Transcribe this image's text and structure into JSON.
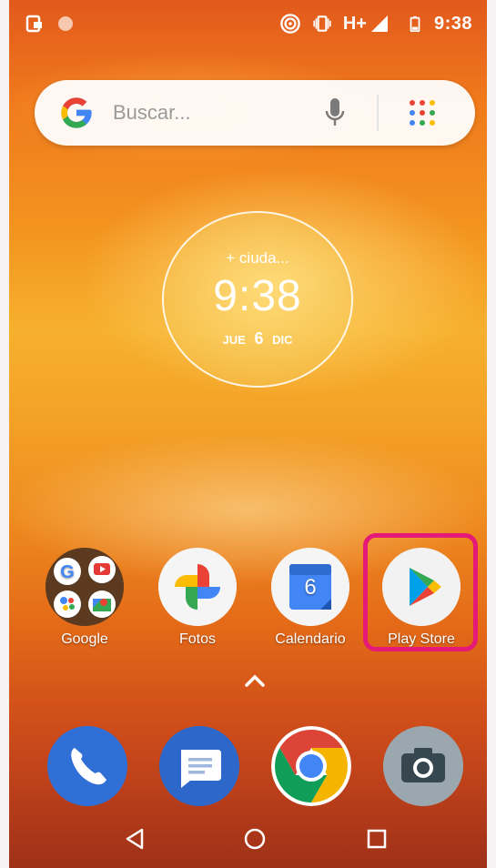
{
  "status_bar": {
    "network": "H+",
    "time": "9:38"
  },
  "search": {
    "placeholder": "Buscar..."
  },
  "clock_widget": {
    "city": "+ ciuda...",
    "time": "9:38",
    "weekday": "JUE",
    "day": "6",
    "month": "DIC"
  },
  "apps": [
    {
      "label": "Google",
      "icon": "google-folder-icon"
    },
    {
      "label": "Fotos",
      "icon": "photos-pinwheel-icon"
    },
    {
      "label": "Calendario",
      "icon": "calendar-icon",
      "badge": "6"
    },
    {
      "label": "Play Store",
      "icon": "play-store-icon"
    }
  ],
  "dock": [
    {
      "icon": "phone-icon"
    },
    {
      "icon": "messages-icon"
    },
    {
      "icon": "chrome-icon"
    },
    {
      "icon": "camera-icon"
    }
  ],
  "nav": [
    "back-icon",
    "home-icon",
    "recents-icon"
  ],
  "colors": {
    "highlight": "#e51a78",
    "phone_blue": "#2f6fd6",
    "messages_blue": "#2d67c9"
  }
}
